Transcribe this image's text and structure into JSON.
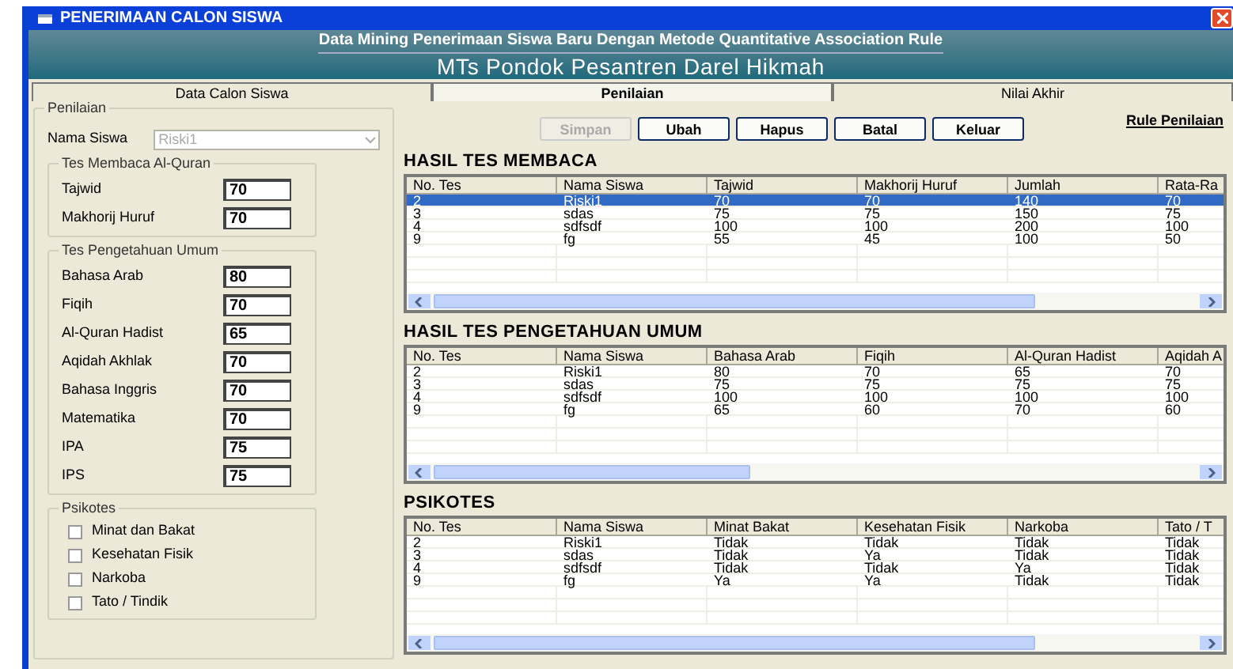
{
  "window": {
    "title": "PENERIMAAN CALON SISWA"
  },
  "banner": {
    "subtitle": "Data Mining Penerimaan Siswa Baru Dengan Metode Quantitative Association Rule",
    "title": "MTs Pondok Pesantren Darel Hikmah"
  },
  "tabs": [
    {
      "label": "Data Calon Siswa",
      "selected": false
    },
    {
      "label": "Penilaian",
      "selected": true
    },
    {
      "label": "Nilai Akhir",
      "selected": false
    }
  ],
  "form": {
    "group_label": "Penilaian",
    "student_label": "Nama Siswa",
    "student_value": "Riski1",
    "student_disabled": true
  },
  "buttons": [
    {
      "label": "Simpan",
      "disabled": true
    },
    {
      "label": "Ubah",
      "disabled": false
    },
    {
      "label": "Hapus",
      "disabled": false
    },
    {
      "label": "Batal",
      "disabled": false
    },
    {
      "label": "Keluar",
      "disabled": false
    }
  ],
  "rule_link": "Rule Penilaian",
  "groups": [
    {
      "title": "Tes Membaca Al-Quran",
      "fields": [
        {
          "label": "Tajwid",
          "value": "70"
        },
        {
          "label": "Makhorij Huruf",
          "value": "70"
        }
      ]
    },
    {
      "title": "Tes Pengetahuan Umum",
      "fields": [
        {
          "label": "Bahasa Arab",
          "value": "80"
        },
        {
          "label": "Fiqih",
          "value": "70"
        },
        {
          "label": "Al-Quran Hadist",
          "value": "65"
        },
        {
          "label": "Aqidah Akhlak",
          "value": "70"
        },
        {
          "label": "Bahasa Inggris",
          "value": "70"
        },
        {
          "label": "Matematika",
          "value": "70"
        },
        {
          "label": "IPA",
          "value": "75"
        },
        {
          "label": "IPS",
          "value": "75"
        }
      ]
    }
  ],
  "psikotes": {
    "title": "Psikotes",
    "options": [
      {
        "label": "Minat dan Bakat",
        "checked": false
      },
      {
        "label": "Kesehatan Fisik",
        "checked": false
      },
      {
        "label": "Narkoba",
        "checked": false
      },
      {
        "label": "Tato / Tindik",
        "checked": false
      }
    ]
  },
  "tables": [
    {
      "title": "HASIL TES MEMBACA",
      "columns": [
        "No. Tes",
        "Nama Siswa",
        "Tajwid",
        "Makhorij Huruf",
        "Jumlah",
        "Rata-Ra"
      ],
      "rows": [
        {
          "cells": [
            "2",
            "Riski1",
            "70",
            "70",
            "140",
            "70"
          ],
          "selected": true
        },
        {
          "cells": [
            "3",
            "sdas",
            "75",
            "75",
            "150",
            "75"
          ],
          "selected": false
        },
        {
          "cells": [
            "4",
            "sdfsdf",
            "100",
            "100",
            "200",
            "100"
          ],
          "selected": false
        },
        {
          "cells": [
            "9",
            "fg",
            "55",
            "45",
            "100",
            "50"
          ],
          "selected": false
        }
      ]
    },
    {
      "title": "HASIL TES PENGETAHUAN UMUM",
      "columns": [
        "No. Tes",
        "Nama Siswa",
        "Bahasa Arab",
        "Fiqih",
        "Al-Quran Hadist",
        "Aqidah A"
      ],
      "rows": [
        {
          "cells": [
            "2",
            "Riski1",
            "80",
            "70",
            "65",
            "70"
          ],
          "selected": false
        },
        {
          "cells": [
            "3",
            "sdas",
            "75",
            "75",
            "75",
            "75"
          ],
          "selected": false
        },
        {
          "cells": [
            "4",
            "sdfsdf",
            "100",
            "100",
            "100",
            "100"
          ],
          "selected": false
        },
        {
          "cells": [
            "9",
            "fg",
            "65",
            "60",
            "70",
            "60"
          ],
          "selected": false
        }
      ]
    },
    {
      "title": "PSIKOTES",
      "columns": [
        "No. Tes",
        "Nama Siswa",
        "Minat Bakat",
        "Kesehatan Fisik",
        "Narkoba",
        "Tato / T"
      ],
      "rows": [
        {
          "cells": [
            "2",
            "Riski1",
            "Tidak",
            "Tidak",
            "Tidak",
            "Tidak"
          ],
          "selected": false
        },
        {
          "cells": [
            "3",
            "sdas",
            "Tidak",
            "Ya",
            "Tidak",
            "Tidak"
          ],
          "selected": false
        },
        {
          "cells": [
            "4",
            "sdfsdf",
            "Tidak",
            "Tidak",
            "Ya",
            "Tidak"
          ],
          "selected": false
        },
        {
          "cells": [
            "9",
            "fg",
            "Ya",
            "Ya",
            "Tidak",
            "Tidak"
          ],
          "selected": false
        }
      ]
    }
  ]
}
